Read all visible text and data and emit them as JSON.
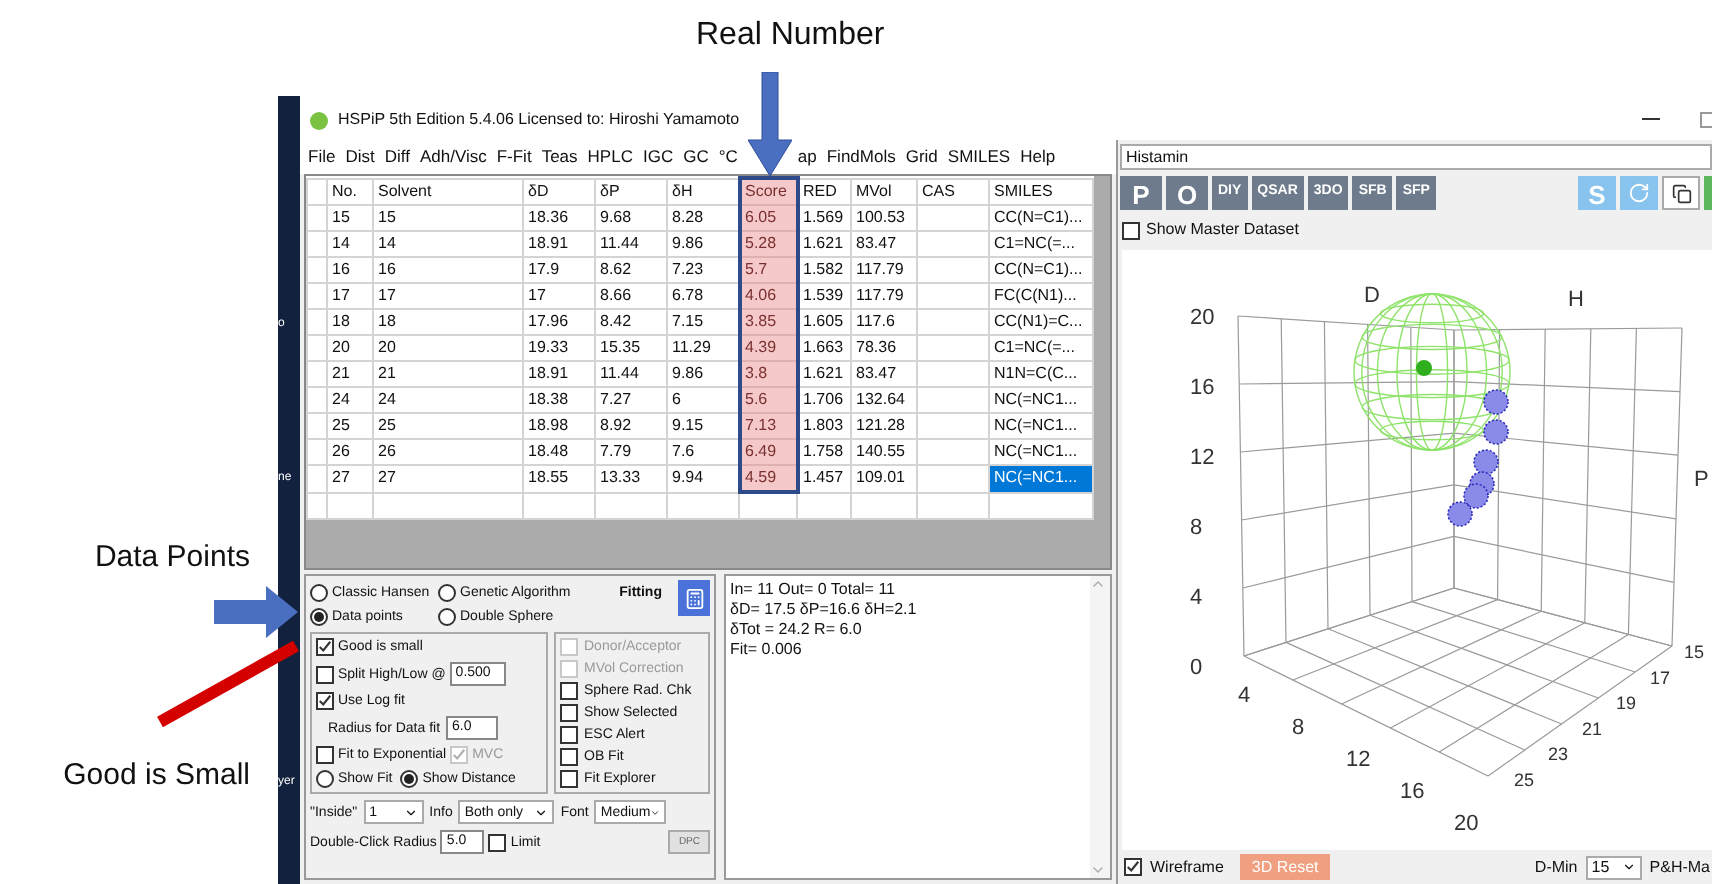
{
  "annotations": {
    "top_label": "Real Number",
    "data_points_label": "Data Points",
    "good_small_label": "Good is Small"
  },
  "desktop_fragments": [
    "o",
    "ne",
    "yer"
  ],
  "window": {
    "title": "HSPiP 5th Edition 5.4.06 Licensed to: Hiroshi Yamamoto"
  },
  "menu": [
    "File",
    "Dist",
    "Diff",
    "Adh/Visc",
    "F-Fit",
    "Teas",
    "HPLC",
    "IGC",
    "GC",
    "°C",
    "ap",
    "FindMols",
    "Grid",
    "SMILES",
    "Help"
  ],
  "table": {
    "columns": [
      {
        "label": "No.",
        "highlighted": false
      },
      {
        "label": "Solvent",
        "highlighted": false
      },
      {
        "label": "δD",
        "highlighted": false
      },
      {
        "label": "δP",
        "highlighted": false
      },
      {
        "label": "δH",
        "highlighted": false
      },
      {
        "label": "Score",
        "highlighted": true
      },
      {
        "label": "RED",
        "highlighted": false
      },
      {
        "label": "MVol",
        "highlighted": false
      },
      {
        "label": "CAS",
        "highlighted": false
      },
      {
        "label": "SMILES",
        "highlighted": false
      }
    ],
    "rows": [
      {
        "no": "15",
        "solvent": "15",
        "d_d": "18.36",
        "d_p": "9.68",
        "d_h": "8.28",
        "score": "6.05",
        "red": "1.569",
        "mvol": "100.53",
        "smiles": "CC(N=C1)...",
        "selected": false
      },
      {
        "no": "14",
        "solvent": "14",
        "d_d": "18.91",
        "d_p": "11.44",
        "d_h": "9.86",
        "score": "5.28",
        "red": "1.621",
        "mvol": "83.47",
        "smiles": "C1=NC(=...",
        "selected": false
      },
      {
        "no": "16",
        "solvent": "16",
        "d_d": "17.9",
        "d_p": "8.62",
        "d_h": "7.23",
        "score": "5.7",
        "red": "1.582",
        "mvol": "117.79",
        "smiles": "CC(N=C1)...",
        "selected": false
      },
      {
        "no": "17",
        "solvent": "17",
        "d_d": "17",
        "d_p": "8.66",
        "d_h": "6.78",
        "score": "4.06",
        "red": "1.539",
        "mvol": "117.79",
        "smiles": "FC(C(N1)...",
        "selected": false
      },
      {
        "no": "18",
        "solvent": "18",
        "d_d": "17.96",
        "d_p": "8.42",
        "d_h": "7.15",
        "score": "3.85",
        "red": "1.605",
        "mvol": "117.6",
        "smiles": "CC(N1)=C...",
        "selected": false
      },
      {
        "no": "20",
        "solvent": "20",
        "d_d": "19.33",
        "d_p": "15.35",
        "d_h": "11.29",
        "score": "4.39",
        "red": "1.663",
        "mvol": "78.36",
        "smiles": "C1=NC(=...",
        "selected": false
      },
      {
        "no": "21",
        "solvent": "21",
        "d_d": "18.91",
        "d_p": "11.44",
        "d_h": "9.86",
        "score": "3.8",
        "red": "1.621",
        "mvol": "83.47",
        "smiles": "N1N=C(C...",
        "selected": false
      },
      {
        "no": "24",
        "solvent": "24",
        "d_d": "18.38",
        "d_p": "7.27",
        "d_h": "6",
        "score": "5.6",
        "red": "1.706",
        "mvol": "132.64",
        "smiles": "NC(=NC1...",
        "selected": false
      },
      {
        "no": "25",
        "solvent": "25",
        "d_d": "18.98",
        "d_p": "8.92",
        "d_h": "9.15",
        "score": "7.13",
        "red": "1.803",
        "mvol": "121.28",
        "smiles": "NC(=NC1...",
        "selected": false
      },
      {
        "no": "26",
        "solvent": "26",
        "d_d": "18.48",
        "d_p": "7.79",
        "d_h": "7.6",
        "score": "6.49",
        "red": "1.758",
        "mvol": "140.55",
        "smiles": "NC(=NC1...",
        "selected": false
      },
      {
        "no": "27",
        "solvent": "27",
        "d_d": "18.55",
        "d_p": "13.33",
        "d_h": "9.94",
        "score": "4.59",
        "red": "1.457",
        "mvol": "109.01",
        "smiles": "NC(=NC1...",
        "selected": true
      }
    ]
  },
  "fitting": {
    "title": "Fitting",
    "methods": [
      {
        "label": "Classic Hansen",
        "selected": false
      },
      {
        "label": "Genetic Algorithm",
        "selected": false
      },
      {
        "label": "Data points",
        "selected": true
      },
      {
        "label": "Double Sphere",
        "selected": false
      }
    ],
    "left_options": [
      {
        "kind": "checkbox",
        "label": "Good is small",
        "checked": true
      },
      {
        "kind": "checkbox_input",
        "label": "Split High/Low @",
        "checked": false,
        "value": "0.500"
      },
      {
        "kind": "checkbox",
        "label": "Use Log fit",
        "checked": true
      },
      {
        "kind": "input",
        "label": "Radius for Data fit",
        "value": "6.0"
      },
      {
        "kind": "checkbox_extra",
        "label": "Fit to Exponential",
        "checked": false,
        "extra_label": "MVC",
        "extra_checked": true
      }
    ],
    "display": [
      {
        "label": "Show Fit",
        "selected": false
      },
      {
        "label": "Show Distance",
        "selected": true
      }
    ],
    "right_options": [
      {
        "label": "Donor/Acceptor",
        "checked": false,
        "disabled": true
      },
      {
        "label": "MVol Correction",
        "checked": false,
        "disabled": true
      },
      {
        "label": "Sphere Rad. Chk",
        "checked": false,
        "disabled": false
      },
      {
        "label": "Show Selected",
        "checked": false,
        "disabled": false
      },
      {
        "label": "ESC Alert",
        "checked": false,
        "disabled": false
      },
      {
        "label": "OB Fit",
        "checked": false,
        "disabled": false
      },
      {
        "label": "Fit Explorer",
        "checked": false,
        "disabled": false
      }
    ],
    "selects": [
      {
        "label": "\"Inside\"",
        "value": "1"
      },
      {
        "label": "Info",
        "value": "Both only"
      },
      {
        "label": "Font",
        "value": "Medium"
      }
    ],
    "radius": {
      "label": "Double-Click Radius",
      "value": "5.0"
    },
    "limit": {
      "label": "Limit",
      "checked": false
    },
    "dpc_button": "DPC"
  },
  "output": {
    "lines": [
      "In= 11 Out= 0 Total= 11",
      "δD= 17.5 δP=16.6 δH=2.1",
      "δTot = 24.2 R= 6.0",
      "Fit= 0.006"
    ]
  },
  "right_panel": {
    "dataset_field": "Histamin",
    "tool_buttons": [
      {
        "label": "P",
        "kind": "dark"
      },
      {
        "label": "O",
        "kind": "dark"
      },
      {
        "label": "DIY",
        "kind": "dark"
      },
      {
        "label": "QSAR",
        "kind": "dark"
      },
      {
        "label": "3DO",
        "kind": "dark"
      },
      {
        "label": "SFB",
        "kind": "dark"
      },
      {
        "label": "SFP",
        "kind": "dark"
      }
    ],
    "side_buttons": [
      {
        "label": "S",
        "kind": "light"
      }
    ],
    "show_master": {
      "label": "Show Master Dataset",
      "checked": false
    },
    "plot": {
      "axis_labels": [
        "D",
        "H",
        "P"
      ],
      "vertical_ticks": [
        "20",
        "16",
        "12",
        "8",
        "4",
        "0"
      ],
      "front_ticks": [
        "4",
        "8",
        "12",
        "16",
        "20"
      ],
      "side_ticks": [
        "15",
        "17",
        "19",
        "21",
        "23",
        "25"
      ]
    },
    "wireframe": {
      "label": "Wireframe",
      "checked": true
    },
    "reset_button": "3D Reset",
    "dmin": {
      "label": "D-Min",
      "value": "15"
    },
    "ph_max_label": "P&H-Ma"
  }
}
